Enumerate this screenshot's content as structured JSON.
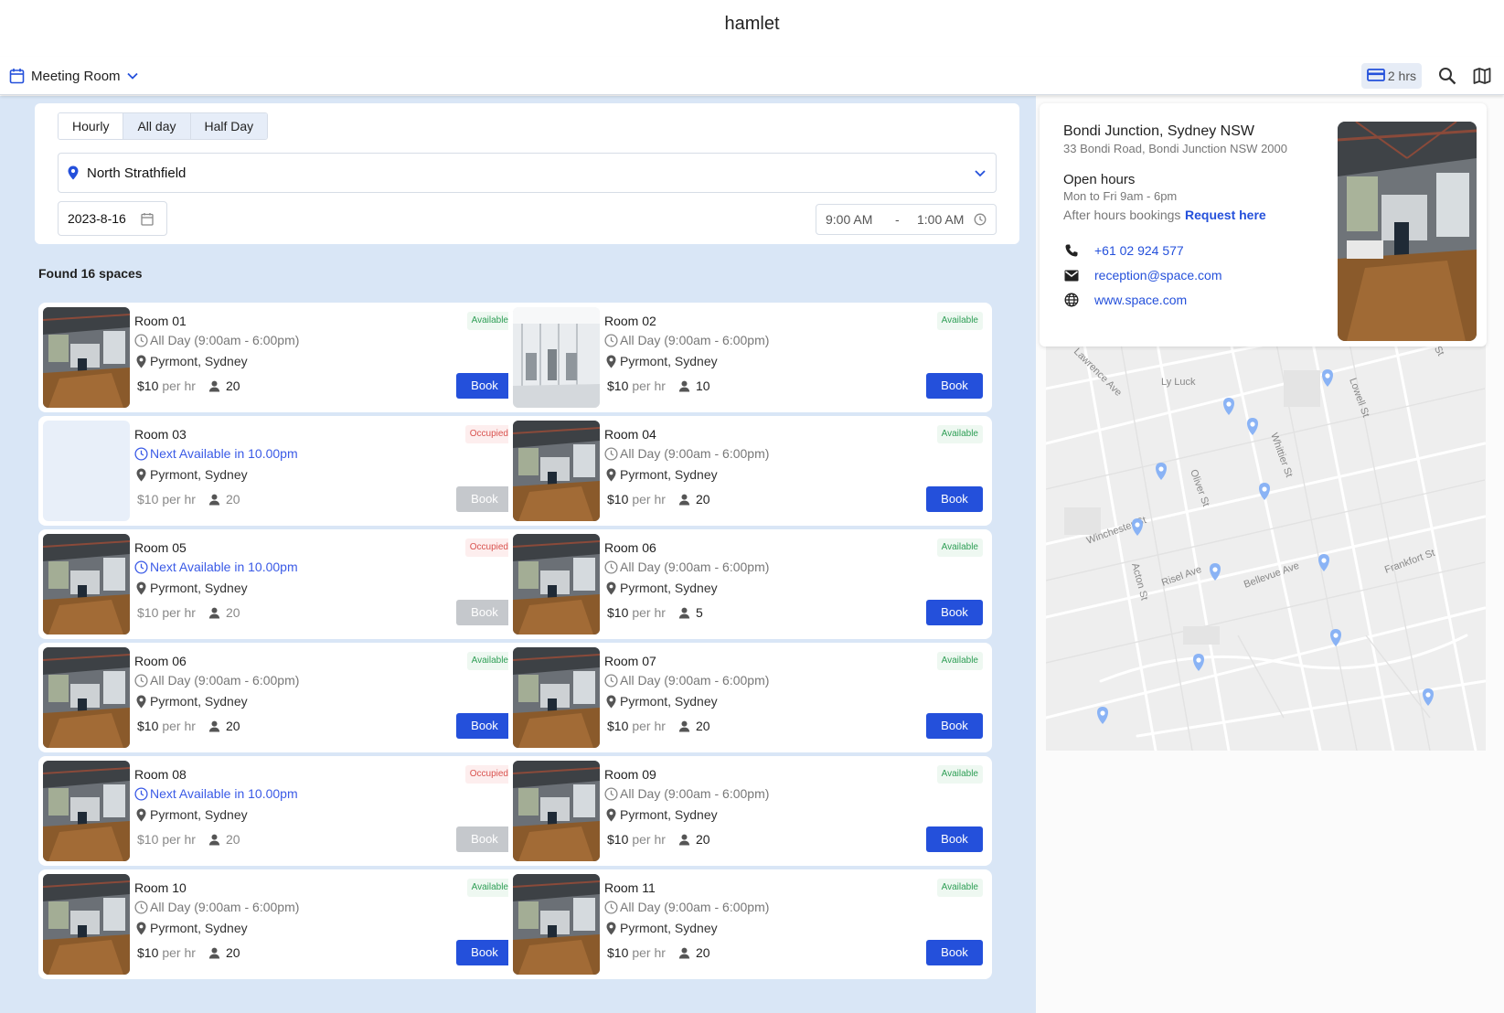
{
  "app": {
    "title": "hamlet"
  },
  "toolbar": {
    "space_type": "Meeting Room",
    "duration_chip": "2 hrs",
    "icons": [
      "calendar-icon",
      "chevron-down-icon",
      "card-icon",
      "search-icon",
      "map-icon"
    ]
  },
  "search": {
    "modes": [
      "Hourly",
      "All day",
      "Half Day"
    ],
    "active_modes": [
      "All day",
      "Half Day"
    ],
    "location": "North Strathfield",
    "date": "2023-8-16",
    "time_from": "9:00 AM",
    "time_separator": "-",
    "time_to": "1:00 AM"
  },
  "results": {
    "found_label": "Found 16 spaces",
    "rooms": [
      {
        "name": "Room 01",
        "status": "Available",
        "hours": "All Day (9:00am - 6:00pm)",
        "location": "Pyrmont, Sydney",
        "price": "$10",
        "unit": "per hr",
        "capacity": "20",
        "book": "Book",
        "photo": "office"
      },
      {
        "name": "Room 02",
        "status": "Available",
        "hours": "All Day (9:00am - 6:00pm)",
        "location": "Pyrmont, Sydney",
        "price": "$10",
        "unit": "per hr",
        "capacity": "10",
        "book": "Book",
        "photo": "gym"
      },
      {
        "name": "Room 03",
        "status": "Occupied",
        "hours": "Next Available in 10.00pm",
        "location": "Pyrmont, Sydney",
        "price": "$10",
        "unit": "per hr",
        "capacity": "20",
        "book": "Book",
        "photo": "none"
      },
      {
        "name": "Room 04",
        "status": "Available",
        "hours": "All Day (9:00am - 6:00pm)",
        "location": "Pyrmont, Sydney",
        "price": "$10",
        "unit": "per hr",
        "capacity": "20",
        "book": "Book",
        "photo": "office"
      },
      {
        "name": "Room 05",
        "status": "Occupied",
        "hours": "Next Available in 10.00pm",
        "location": "Pyrmont, Sydney",
        "price": "$10",
        "unit": "per hr",
        "capacity": "20",
        "book": "Book",
        "photo": "office"
      },
      {
        "name": "Room 06",
        "status": "Available",
        "hours": "All Day (9:00am - 6:00pm)",
        "location": "Pyrmont, Sydney",
        "price": "$10",
        "unit": "per hr",
        "capacity": "5",
        "book": "Book",
        "photo": "office"
      },
      {
        "name": "Room 06",
        "status": "Available",
        "hours": "All Day (9:00am - 6:00pm)",
        "location": "Pyrmont, Sydney",
        "price": "$10",
        "unit": "per hr",
        "capacity": "20",
        "book": "Book",
        "photo": "office"
      },
      {
        "name": "Room 07",
        "status": "Available",
        "hours": "All Day (9:00am - 6:00pm)",
        "location": "Pyrmont, Sydney",
        "price": "$10",
        "unit": "per hr",
        "capacity": "20",
        "book": "Book",
        "photo": "office"
      },
      {
        "name": "Room 08",
        "status": "Occupied",
        "hours": "Next Available in 10.00pm",
        "location": "Pyrmont, Sydney",
        "price": "$10",
        "unit": "per hr",
        "capacity": "20",
        "book": "Book",
        "photo": "office"
      },
      {
        "name": "Room 09",
        "status": "Available",
        "hours": "All Day (9:00am - 6:00pm)",
        "location": "Pyrmont, Sydney",
        "price": "$10",
        "unit": "per hr",
        "capacity": "20",
        "book": "Book",
        "photo": "office"
      },
      {
        "name": "Room 10",
        "status": "Available",
        "hours": "All Day (9:00am - 6:00pm)",
        "location": "Pyrmont, Sydney",
        "price": "$10",
        "unit": "per hr",
        "capacity": "20",
        "book": "Book",
        "photo": "office"
      },
      {
        "name": "Room 11",
        "status": "Available",
        "hours": "All Day (9:00am - 6:00pm)",
        "location": "Pyrmont, Sydney",
        "price": "$10",
        "unit": "per hr",
        "capacity": "20",
        "book": "Book",
        "photo": "office"
      }
    ]
  },
  "venue": {
    "name": "Bondi Junction, Sydney NSW",
    "address": "33 Bondi Road, Bondi Junction NSW 2000",
    "open_title": "Open hours",
    "open_hours": "Mon to Fri 9am - 6pm",
    "after_hours": "After hours bookings",
    "request_link": "Request here",
    "phone": "+61 02 924 577",
    "email": "reception@space.com",
    "website": "www.space.com"
  },
  "map": {
    "street_labels": [
      "Lawrence Ave",
      "Ly Luck",
      "Lowell St",
      "Whittier St",
      "Oliver St",
      "Winchester St",
      "Acton St",
      "Risel Ave",
      "Bellevue Ave",
      "Frankfort St",
      "St",
      "St",
      "g St"
    ],
    "pin_count": 12
  },
  "colors": {
    "accent": "#2450db",
    "left_background": "#d9e6f6",
    "available": "#2e9e55",
    "occupied": "#d9534f",
    "disabled_button": "#c5c8cc",
    "map_pin": "#8ab3f5"
  }
}
